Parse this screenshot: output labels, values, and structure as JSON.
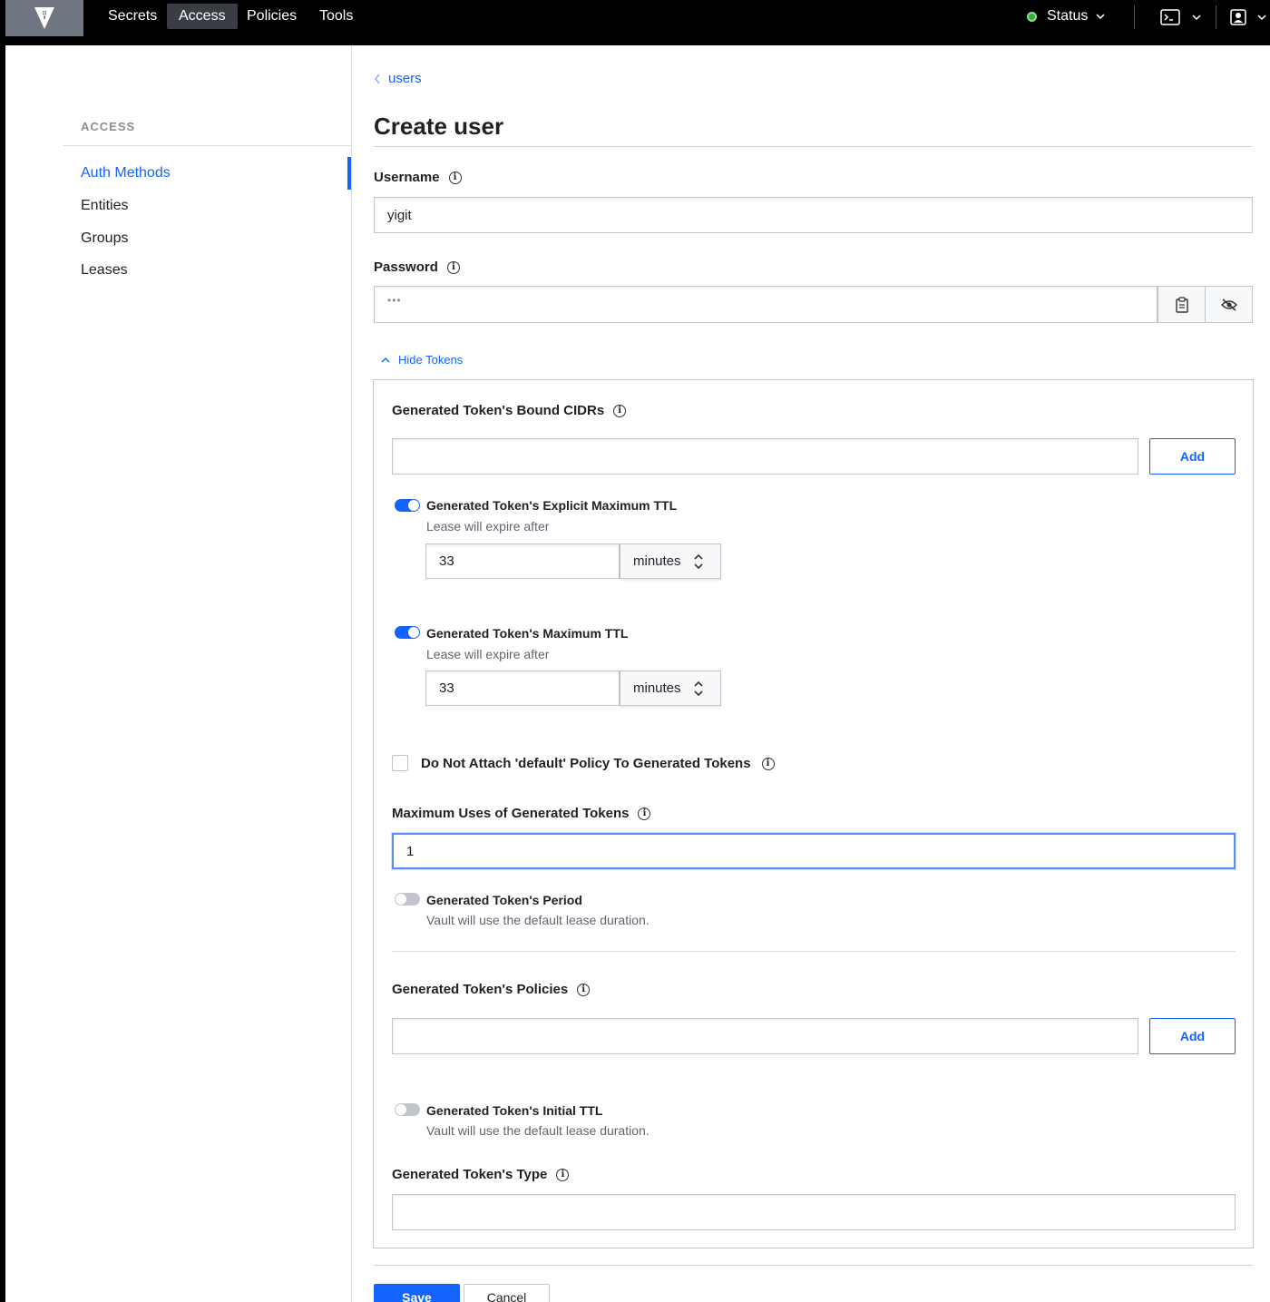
{
  "nav": {
    "links": [
      "Secrets",
      "Access",
      "Policies",
      "Tools"
    ],
    "active": "Access",
    "status_label": "Status"
  },
  "sidebar": {
    "heading": "ACCESS",
    "items": [
      "Auth Methods",
      "Entities",
      "Groups",
      "Leases"
    ],
    "active": "Auth Methods"
  },
  "breadcrumb": {
    "label": "users"
  },
  "page": {
    "title": "Create user"
  },
  "form": {
    "username": {
      "label": "Username",
      "value": "yigit"
    },
    "password": {
      "label": "Password",
      "value": "•••"
    },
    "hide_tokens": "Hide Tokens",
    "bound_cidrs": {
      "label": "Generated Token's Bound CIDRs",
      "value": "",
      "add": "Add"
    },
    "explicit_max_ttl": {
      "label": "Generated Token's Explicit Maximum TTL",
      "sub": "Lease will expire after",
      "value": "33",
      "unit": "minutes",
      "enabled": true
    },
    "max_ttl": {
      "label": "Generated Token's Maximum TTL",
      "sub": "Lease will expire after",
      "value": "33",
      "unit": "minutes",
      "enabled": true
    },
    "no_default_policy": {
      "label": "Do Not Attach 'default' Policy To Generated Tokens",
      "checked": false
    },
    "max_uses": {
      "label": "Maximum Uses of Generated Tokens",
      "value": "1"
    },
    "period": {
      "label": "Generated Token's Period",
      "sub": "Vault will use the default lease duration.",
      "enabled": false
    },
    "policies": {
      "label": "Generated Token's Policies",
      "value": "",
      "add": "Add"
    },
    "initial_ttl": {
      "label": "Generated Token's Initial TTL",
      "sub": "Vault will use the default lease duration.",
      "enabled": false
    },
    "token_type": {
      "label": "Generated Token's Type",
      "value": ""
    }
  },
  "actions": {
    "save": "Save",
    "cancel": "Cancel"
  },
  "colors": {
    "accent": "#1563ff",
    "nav_bg": "#000000",
    "status_ok": "#2eb039"
  }
}
